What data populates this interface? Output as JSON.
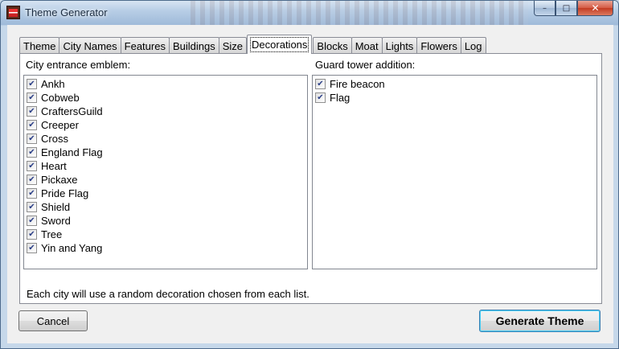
{
  "window": {
    "title": "Theme Generator",
    "controls": {
      "minimize_glyph": "–",
      "maximize_glyph": "□",
      "close_glyph": "✕"
    }
  },
  "tabs": [
    {
      "label": "Theme",
      "active": false
    },
    {
      "label": "City Names",
      "active": false
    },
    {
      "label": "Features",
      "active": false
    },
    {
      "label": "Buildings",
      "active": false
    },
    {
      "label": "Size",
      "active": false
    },
    {
      "label": "Decorations",
      "active": true
    },
    {
      "label": "Blocks",
      "active": false
    },
    {
      "label": "Moat",
      "active": false
    },
    {
      "label": "Lights",
      "active": false
    },
    {
      "label": "Flowers",
      "active": false
    },
    {
      "label": "Log",
      "active": false
    }
  ],
  "decorations": {
    "emblem_label": "City entrance emblem:",
    "emblems": [
      {
        "label": "Ankh",
        "checked": true
      },
      {
        "label": "Cobweb",
        "checked": true
      },
      {
        "label": "CraftersGuild",
        "checked": true
      },
      {
        "label": "Creeper",
        "checked": true
      },
      {
        "label": "Cross",
        "checked": true
      },
      {
        "label": "England Flag",
        "checked": true
      },
      {
        "label": "Heart",
        "checked": true
      },
      {
        "label": "Pickaxe",
        "checked": true
      },
      {
        "label": "Pride Flag",
        "checked": true
      },
      {
        "label": "Shield",
        "checked": true
      },
      {
        "label": "Sword",
        "checked": true
      },
      {
        "label": "Tree",
        "checked": true
      },
      {
        "label": "Yin and Yang",
        "checked": true
      }
    ],
    "tower_label": "Guard tower addition:",
    "towers": [
      {
        "label": "Fire beacon",
        "checked": true
      },
      {
        "label": "Flag",
        "checked": true
      }
    ],
    "note": "Each city will use a random decoration chosen from each list."
  },
  "buttons": {
    "cancel": "Cancel",
    "generate": "Generate Theme"
  },
  "check_glyph": "✔"
}
